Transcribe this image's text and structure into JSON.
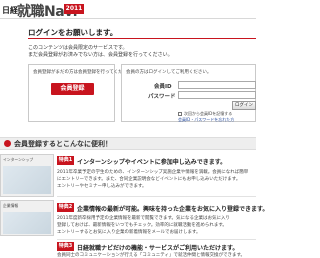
{
  "header": {
    "logo_prefix": "日経",
    "logo_main": "就職Navi",
    "logo_year": "2011"
  },
  "page": {
    "title": "ログインをお願いします。",
    "intro_lines": [
      "このコンテンツは会員限定のサービスです。",
      "まだ会員登録がお済みでない方は、会員登録を行ってください。"
    ]
  },
  "register_box": {
    "caption": "会員登録がまだの方は会員登録を行ってください",
    "button_label": "会員登録"
  },
  "login_box": {
    "caption": "会員の方はログインしてご利用ください。",
    "id_label": "会員ID",
    "password_label": "パスワード",
    "login_button": "ログイン",
    "remember_label": "次回から会員IDを記憶する",
    "forgot_link": "会員ID・パスワードを忘れた方"
  },
  "benefits": {
    "title": "会員登録するとこんなに便利！",
    "thumbnail_captions": [
      "インターンシップ",
      "企業情報"
    ],
    "items": [
      {
        "badge": "特典1",
        "heading": "インターンシップやイベントに参加申し込みできます。",
        "lines": [
          "2011年卒業予定の学生のための、インターンシップ実施企業や情報を満載。会員になれば簡単",
          "にエントリーできます。また、合同企業説明会などイベントにもお申し込みいただけます。",
          "エントリーやセミナー申し込みができます。"
        ]
      },
      {
        "badge": "特典2",
        "heading": "企業情報の最新が可能。興味を持った企業をお気に入り登録できます。",
        "lines": [
          "2011年度新卒採用予定の企業情報を最新で閲覧できます。気になる企業はお気に入り",
          "登録しておけば、最新情報をいつでもチェック。効率的に就職活動を進められます。",
          "エントリーするとお気に入り企業の新着情報をメールでお届けします。"
        ]
      },
      {
        "badge": "特典3",
        "heading": "日経就職ナビだけの機能・サービスがご利用いただけます。",
        "lines": [
          "会員同士のコミュニケーションが行える「コミュニティ」で就活仲間と情報交換ができます。"
        ]
      }
    ]
  },
  "colors": {
    "accent": "#c8141e",
    "background": "#ffffff"
  }
}
